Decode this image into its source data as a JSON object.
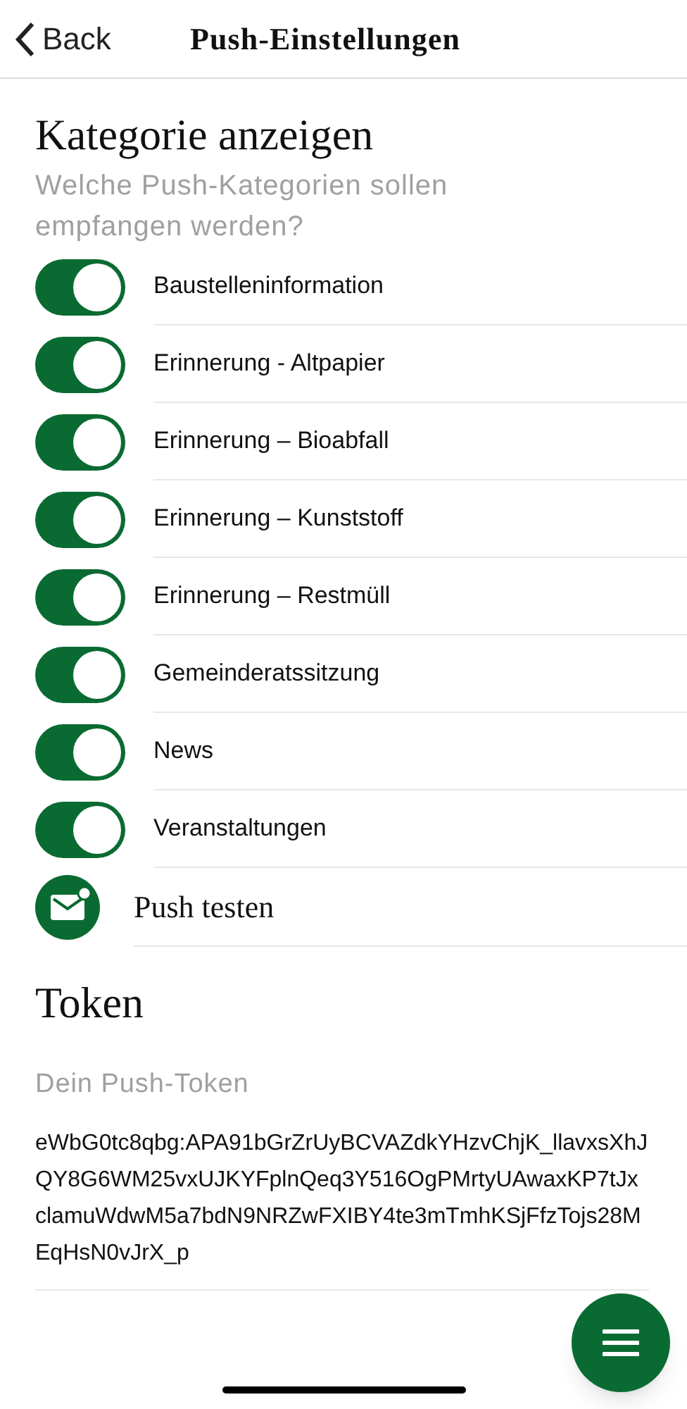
{
  "nav": {
    "back": "Back",
    "title": "Push-Einstellungen"
  },
  "categories": {
    "title": "Kategorie anzeigen",
    "subtitle": "Welche Push-Kategorien sollen empfangen werden?",
    "items": [
      {
        "label": "Baustelleninformation",
        "on": true
      },
      {
        "label": "Erinnerung - Altpapier",
        "on": true
      },
      {
        "label": "Erinnerung – Bioabfall",
        "on": true
      },
      {
        "label": "Erinnerung – Kunststoff",
        "on": true
      },
      {
        "label": "Erinnerung – Restmüll",
        "on": true
      },
      {
        "label": "Gemeinderatssitzung",
        "on": true
      },
      {
        "label": "News",
        "on": true
      },
      {
        "label": "Veranstaltungen",
        "on": true
      }
    ]
  },
  "test_push": {
    "label": "Push testen"
  },
  "token": {
    "title": "Token",
    "label": "Dein Push-Token",
    "value": "eWbG0tc8qbg:APA91bGrZrUyBCVAZdkYHzvChjK_llavxsXhJQY8G6WM25vxUJKYFplnQeq3Y516OgPMrtyUAwaxKP7tJxclamuWdwM5a7bdN9NRZwFXIBY4te3mTmhKSjFfzTojs28MEqHsN0vJrX_p"
  }
}
